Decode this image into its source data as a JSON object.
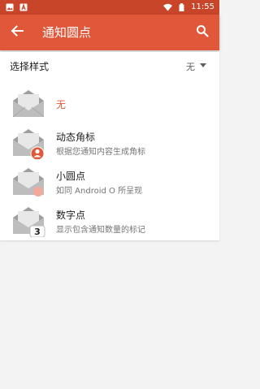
{
  "status_bar": {
    "time": "11:55",
    "left_icons": [
      "image-icon",
      "text-a-icon"
    ],
    "right_icons": [
      "wifi-icon",
      "battery-icon"
    ],
    "background": "#c8452a"
  },
  "toolbar": {
    "title": "通知圆点",
    "back_icon": "arrow-back-icon",
    "search_icon": "search-icon",
    "background": "#e0573a"
  },
  "selector": {
    "label": "选择样式",
    "value": "无"
  },
  "options": [
    {
      "title": "无",
      "subtitle": "",
      "badge": "none",
      "selected": true
    },
    {
      "title": "动态角标",
      "subtitle": "根据您通知内容生成角标",
      "badge": "avatar"
    },
    {
      "title": "小圆点",
      "subtitle": "如同 Android O 所呈现",
      "badge": "dot"
    },
    {
      "title": "数字点",
      "subtitle": "显示包含通知数量的标记",
      "badge": "number",
      "badge_text": "3"
    }
  ],
  "colors": {
    "accent": "#e0573a",
    "badge_orange": "#e0573a",
    "dot_pink": "#f2a99a",
    "envelope": "#9e9e9e"
  }
}
